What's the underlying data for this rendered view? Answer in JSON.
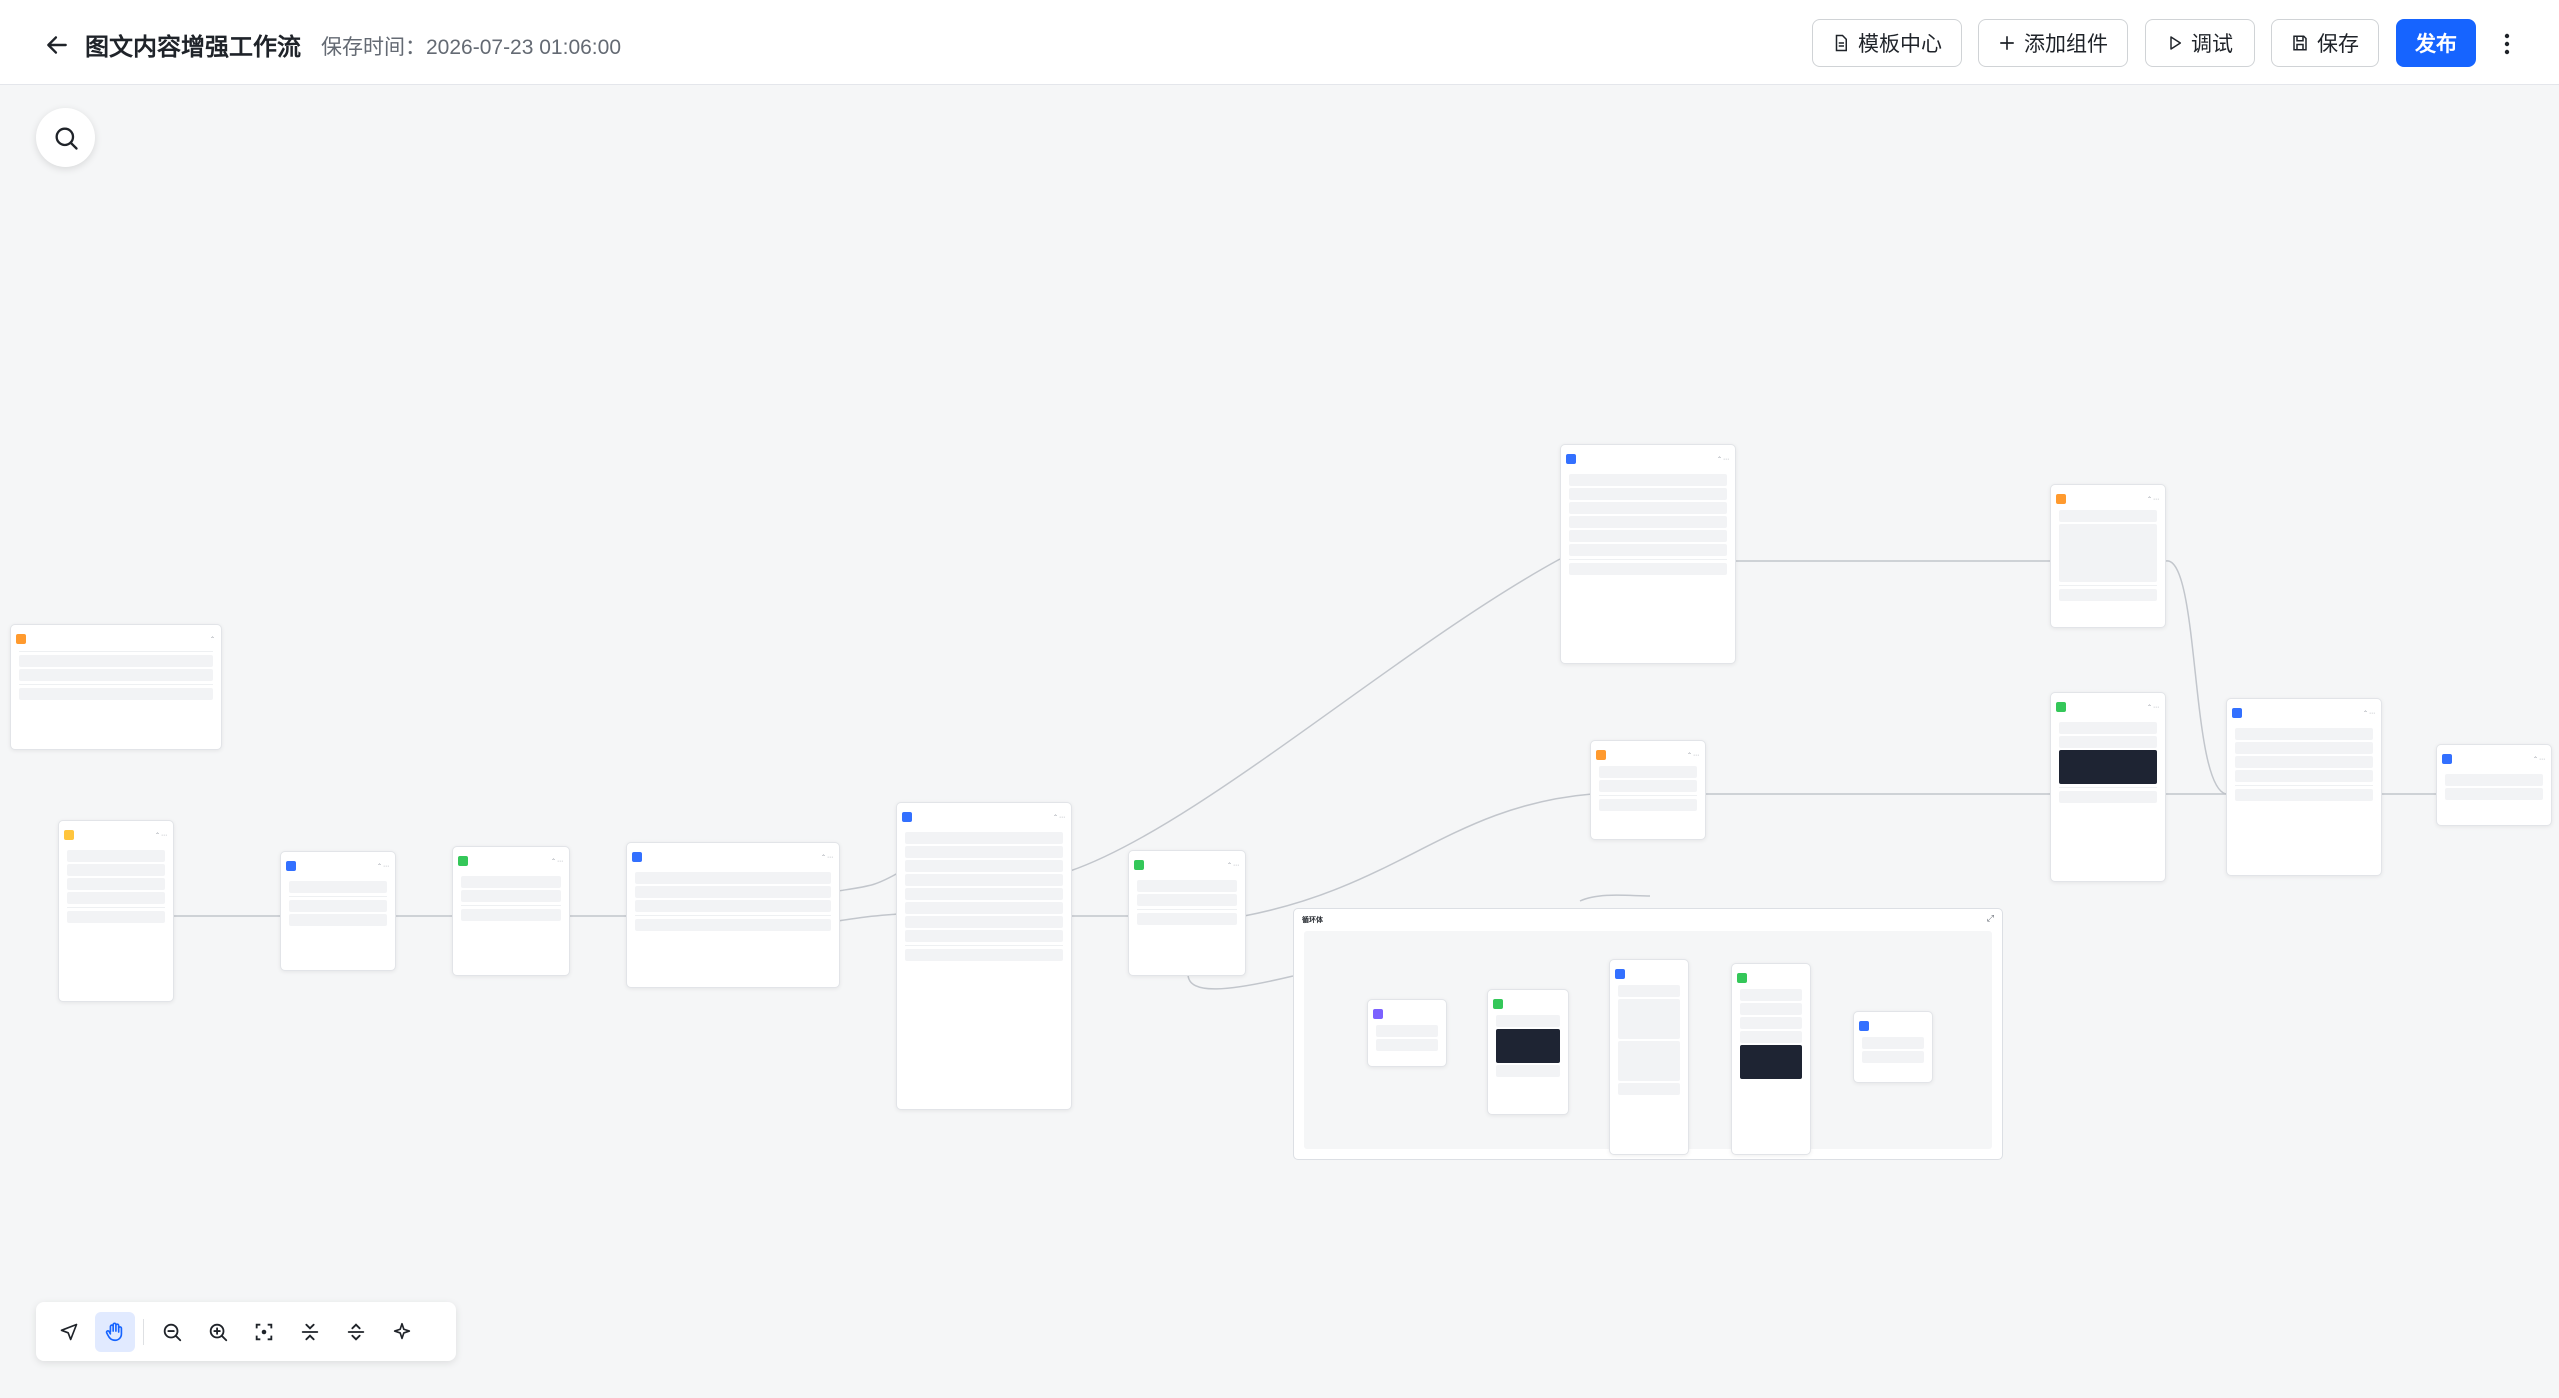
{
  "header": {
    "title": "图文内容增强工作流",
    "save_time": "保存时间：2026-07-23 01:06:00",
    "buttons": {
      "template": "模板中心",
      "add": "添加组件",
      "debug": "调试",
      "save": "保存",
      "publish": "发布"
    }
  },
  "colors": {
    "accent": "#1664ff",
    "orange": "#ff9a2e",
    "green": "#34c759",
    "blue": "#3370ff",
    "purple": "#7b61ff",
    "yellow": "#ffc53d"
  },
  "icons": {
    "back": "arrow-left-icon",
    "search": "search-icon",
    "more": "more-vertical-icon"
  },
  "group": {
    "title": "循环体"
  },
  "toolbar": {
    "tools": [
      "pointer",
      "hand",
      "zoom-out",
      "zoom-in",
      "fit-view",
      "collapse",
      "expand",
      "auto-layout"
    ]
  }
}
